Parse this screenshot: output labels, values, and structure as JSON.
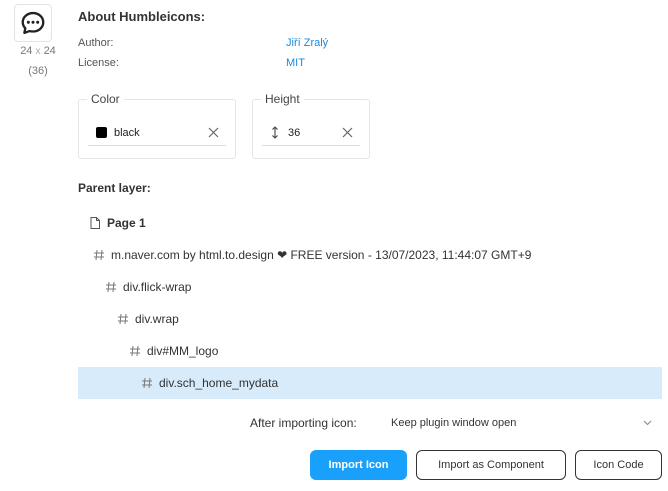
{
  "icon": {
    "name": "chat-bubble-icon",
    "width": "24",
    "separator": "x",
    "height": "24",
    "count": "(36)"
  },
  "about": {
    "title": "About Humbleicons:",
    "author_label": "Author:",
    "author_value": "Jiří Zralý",
    "license_label": "License:",
    "license_value": "MIT"
  },
  "color_field": {
    "legend": "Color",
    "value": "black",
    "swatch": "#000000"
  },
  "height_field": {
    "legend": "Height",
    "value": "36"
  },
  "parent_layer": {
    "label": "Parent layer:",
    "layers": [
      {
        "label": "Page 1",
        "type": "page",
        "depth": 0,
        "selected": false
      },
      {
        "label": "m.naver.com by html.to.design ❤ FREE version - 13/07/2023, 11:44:07 GMT+9",
        "type": "frame",
        "depth": 1,
        "selected": false
      },
      {
        "label": "div.flick-wrap",
        "type": "frame",
        "depth": 2,
        "selected": false
      },
      {
        "label": "div.wrap",
        "type": "frame",
        "depth": 3,
        "selected": false
      },
      {
        "label": "div#MM_logo",
        "type": "frame",
        "depth": 4,
        "selected": false
      },
      {
        "label": "div.sch_home_mydata",
        "type": "frame",
        "depth": 5,
        "selected": true
      }
    ]
  },
  "after_import": {
    "label": "After importing icon:",
    "selected": "Keep plugin window open"
  },
  "buttons": {
    "import_icon": "Import Icon",
    "import_component": "Import as Component",
    "icon_code": "Icon Code"
  },
  "colors": {
    "accent": "#18a0fb",
    "link": "#1a8bdc",
    "selected_row": "#d7ebfb"
  }
}
